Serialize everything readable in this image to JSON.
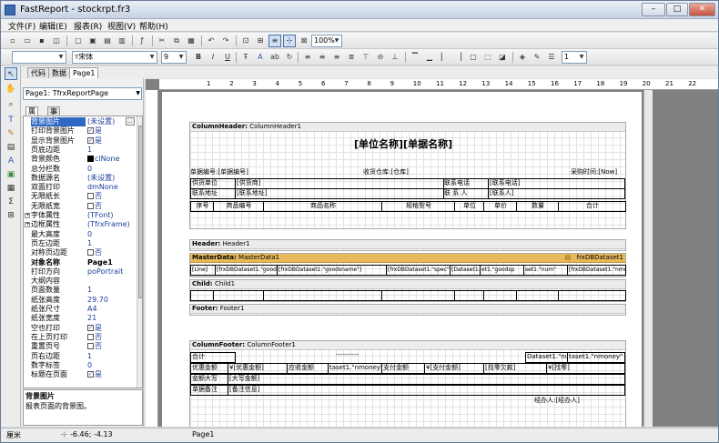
{
  "window": {
    "title": "FastReport - stockrpt.fr3",
    "controls": {
      "min": "–",
      "max": "□",
      "close": "✕"
    }
  },
  "menu": {
    "items": [
      "文件(F)",
      "编辑(E)",
      "报表(R)",
      "视图(V)",
      "帮助(H)"
    ]
  },
  "toolbar": {
    "zoom": "100%",
    "font_name": "宋体",
    "font_size": "9",
    "line_width": "1"
  },
  "tabs": {
    "items": [
      "代码",
      "数据",
      "Page1"
    ]
  },
  "inspector": {
    "object": "Page1: TfrxReportPage",
    "tabs": [
      "属性",
      "事件"
    ],
    "rows": [
      {
        "name": "背景图片",
        "value": "(未设置)",
        "kind": "text",
        "bold": false,
        "expand": false,
        "selected": true,
        "dots": "…"
      },
      {
        "name": "打印背景图片",
        "value": "是",
        "kind": "check",
        "bold": false,
        "expand": false
      },
      {
        "name": "显示背景图片",
        "value": "是",
        "kind": "check",
        "bold": false,
        "expand": false
      },
      {
        "name": "页底边距",
        "value": "1",
        "kind": "text",
        "bold": false,
        "expand": false
      },
      {
        "name": "背景颜色",
        "value": "clNone",
        "kind": "color",
        "bold": false,
        "expand": false
      },
      {
        "name": "总分栏数",
        "value": "0",
        "kind": "text",
        "bold": false,
        "expand": false
      },
      {
        "name": "数据源名",
        "value": "(未设置)",
        "kind": "text",
        "bold": false,
        "expand": false
      },
      {
        "name": "双面打印",
        "value": "dmNone",
        "kind": "text",
        "bold": false,
        "expand": false
      },
      {
        "name": "无限纸长",
        "value": "否",
        "kind": "uncheck",
        "bold": false,
        "expand": false
      },
      {
        "name": "无限纸宽",
        "value": "否",
        "kind": "uncheck",
        "bold": false,
        "expand": false
      },
      {
        "name": "字体属性",
        "value": "(TFont)",
        "kind": "text",
        "bold": false,
        "expand": true
      },
      {
        "name": "边框属性",
        "value": "(TfrxFrame)",
        "kind": "text",
        "bold": false,
        "expand": true
      },
      {
        "name": "最大高度",
        "value": "0",
        "kind": "text",
        "bold": false,
        "expand": false
      },
      {
        "name": "页左边距",
        "value": "1",
        "kind": "text",
        "bold": false,
        "expand": false
      },
      {
        "name": "对称页边距",
        "value": "否",
        "kind": "uncheck",
        "bold": false,
        "expand": false
      },
      {
        "name": "对象名称",
        "value": "Page1",
        "kind": "text",
        "bold": true,
        "expand": false
      },
      {
        "name": "打印方向",
        "value": "poPortrait",
        "kind": "text",
        "bold": false,
        "expand": false
      },
      {
        "name": "大纲内容",
        "value": "",
        "kind": "text",
        "bold": false,
        "expand": false
      },
      {
        "name": "页面数量",
        "value": "1",
        "kind": "text",
        "bold": false,
        "expand": false
      },
      {
        "name": "纸张高度",
        "value": "29.70",
        "kind": "text",
        "bold": false,
        "expand": false
      },
      {
        "name": "纸张尺寸",
        "value": "A4",
        "kind": "text",
        "bold": false,
        "expand": false
      },
      {
        "name": "纸张宽度",
        "value": "21",
        "kind": "text",
        "bold": false,
        "expand": false
      },
      {
        "name": "空也打印",
        "value": "是",
        "kind": "check",
        "bold": false,
        "expand": false
      },
      {
        "name": "在上页打印",
        "value": "否",
        "kind": "uncheck",
        "bold": false,
        "expand": false
      },
      {
        "name": "重置页号",
        "value": "否",
        "kind": "uncheck",
        "bold": false,
        "expand": false
      },
      {
        "name": "页右边距",
        "value": "1",
        "kind": "text",
        "bold": false,
        "expand": false
      },
      {
        "name": "数字标签",
        "value": "0",
        "kind": "text",
        "bold": false,
        "expand": false
      },
      {
        "name": "标题在页面",
        "value": "是",
        "kind": "check",
        "bold": false,
        "expand": false
      }
    ],
    "desc_title": "背景图片",
    "desc_text": "报表页面的背景图。"
  },
  "ruler": [
    "1",
    "2",
    "3",
    "4",
    "5",
    "6",
    "7",
    "8",
    "9",
    "10",
    "11",
    "12",
    "13",
    "14",
    "15",
    "16",
    "17",
    "18",
    "19",
    "20",
    "21",
    "22"
  ],
  "report": {
    "col_header_band": "ColumnHeader:",
    "col_header_name": "ColumnHeader1",
    "title": "[单位名称][单据名称]",
    "doc_no": "单据编号:[单据编号]",
    "warehouse": "收货仓库:[仓库]",
    "purchase_time": "采购时间:[Now]",
    "supplier_label": "供货单位",
    "supplier_value": "[供货商]",
    "phone_label": "联系电话",
    "phone_value": "[联系电话]",
    "address_label": "联系地址",
    "address_value": "[联系地址]",
    "contact_label": "联 系 人",
    "contact_value": "[联系人]",
    "columns": [
      "序号",
      "商品编号",
      "商品名称",
      "规格型号",
      "单位",
      "单价",
      "数量",
      "合计"
    ],
    "header_band": "Header:",
    "header_name": "Header1",
    "master_band": "MasterData:",
    "master_name": "MasterData1",
    "master_dataset": "frxDBDataset1",
    "master_cells": [
      "[Line]",
      "[frxDBDataset1.\"goodsid\"]",
      "[frxDBDataset1.\"goodsname\"]",
      "[frxDBDataset1.\"spec\"]",
      "[Dataset1.\"un",
      "et1.\"goodsp",
      "set1.\"num\"",
      "[frxDBDataset1.\"nmoney\""
    ],
    "child_band": "Child:",
    "child_name": "Child1",
    "footer_band": "Footer:",
    "footer_name": "Footer1",
    "col_footer_band": "ColumnFooter:",
    "col_footer_name": "ColumnFooter1",
    "sum_label": "合计",
    "sum_dash": "----------",
    "sum_num": "Dataset1.\"num\">Mas",
    "sum_money": "taset1.\"nmoney\"",
    "discount_label": "优惠金额",
    "discount_value": "¥[优惠金额]",
    "payable_label": "应收金额",
    "payable_value": "taset1.\"nmoney\">MasterData1]-",
    "paid_label": "支付金额",
    "paid_value": "¥[支付金额]",
    "due_value": "[找零欠款]",
    "change_value": "¥[找零]",
    "upper_label": "金额大写",
    "upper_value": "[大写金额]",
    "note_label": "单据备注",
    "note_value": "[备注信息]",
    "operator": "经办人:[经办人]"
  },
  "status": {
    "unit": "厘米",
    "pos": "-6.46; -4.13",
    "page": "Page1"
  }
}
